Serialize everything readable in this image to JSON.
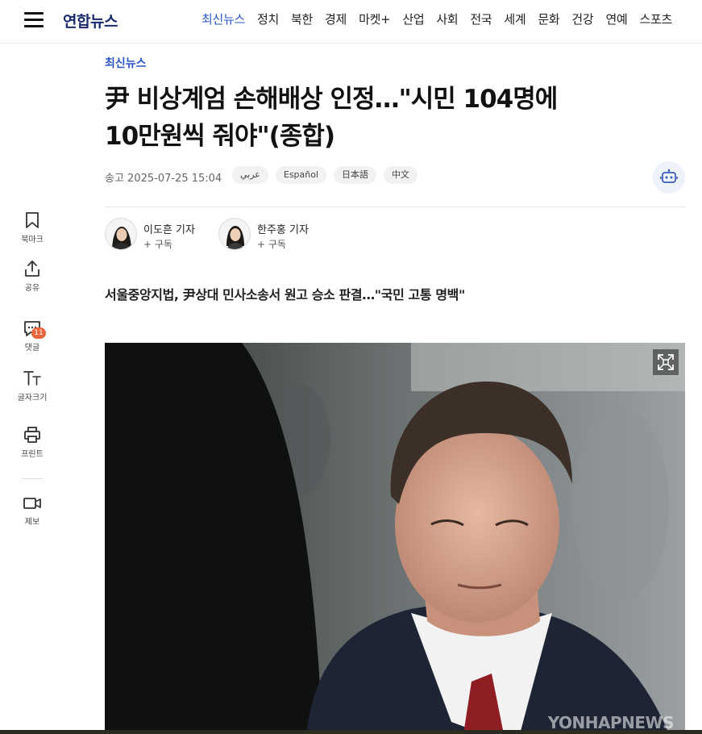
{
  "header": {
    "logo": "연합뉴스",
    "nav": [
      "최신뉴스",
      "정치",
      "북한",
      "경제",
      "마켓+",
      "산업",
      "사회",
      "전국",
      "세계",
      "문화",
      "건강",
      "연예",
      "스포츠"
    ],
    "active_index": 0,
    "accent_color": "#2a56c6"
  },
  "rail": {
    "bookmark": "북마크",
    "share": "공유",
    "comments": "댓글",
    "comment_count": "11",
    "font_size": "글자크기",
    "print": "프린트",
    "report": "제보"
  },
  "article": {
    "section": "최신뉴스",
    "headline_line1": "尹 비상계엄 손해배상 인정…\"시민 104명에",
    "headline_line2": "10만원씩 줘야\"(종합)",
    "published": "송고 2025-07-25 15:04",
    "languages": [
      "عربي",
      "Español",
      "日本語",
      "中文"
    ],
    "reporters": [
      {
        "name": "이도흔 기자",
        "subscribe": "+ 구독"
      },
      {
        "name": "한주홍 기자",
        "subscribe": "+ 구독"
      }
    ],
    "subheadline": "서울중앙지법, 尹상대 민사소송서 원고 승소 판결…\"국민 고통 명백\"",
    "photo_watermark": "YONHAPNEWS"
  }
}
